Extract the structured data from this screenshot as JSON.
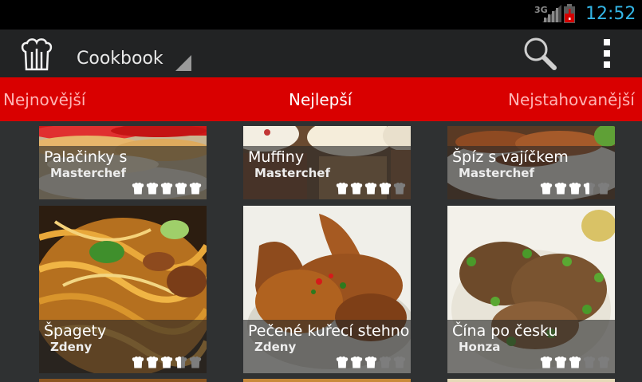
{
  "status_bar": {
    "network": "3G",
    "time": "12:52",
    "colors": {
      "time": "#33b5e5",
      "battery_alert": "#d40000"
    }
  },
  "action_bar": {
    "logo_icon": "chef-hat-icon",
    "title": "Cookbook",
    "search_icon": "search-icon",
    "overflow_icon": "more-vert-icon"
  },
  "tabs": {
    "items": [
      {
        "label": "Nejnovější",
        "active": false
      },
      {
        "label": "Nejlepší",
        "active": true
      },
      {
        "label": "Nejstahovanější",
        "active": false
      }
    ],
    "colors": {
      "background": "#d90000",
      "inactive_text": "#ffb4b4",
      "active_text": "#ffffff"
    }
  },
  "recipes": [
    {
      "name": "Palačinky s",
      "author": "Masterchef",
      "rating": 5
    },
    {
      "name": "Muffiny",
      "author": "Masterchef",
      "rating": 4
    },
    {
      "name": "Špíz s vajíčkem",
      "author": "Masterchef",
      "rating": 3.5
    },
    {
      "name": "Špagety",
      "author": "Zdeny",
      "rating": 3.5
    },
    {
      "name": "Pečené kuřecí stehno",
      "author": "Zdeny",
      "rating": 3
    },
    {
      "name": "Čína po česku",
      "author": "Honza",
      "rating": 3
    }
  ],
  "rating_max": 5
}
